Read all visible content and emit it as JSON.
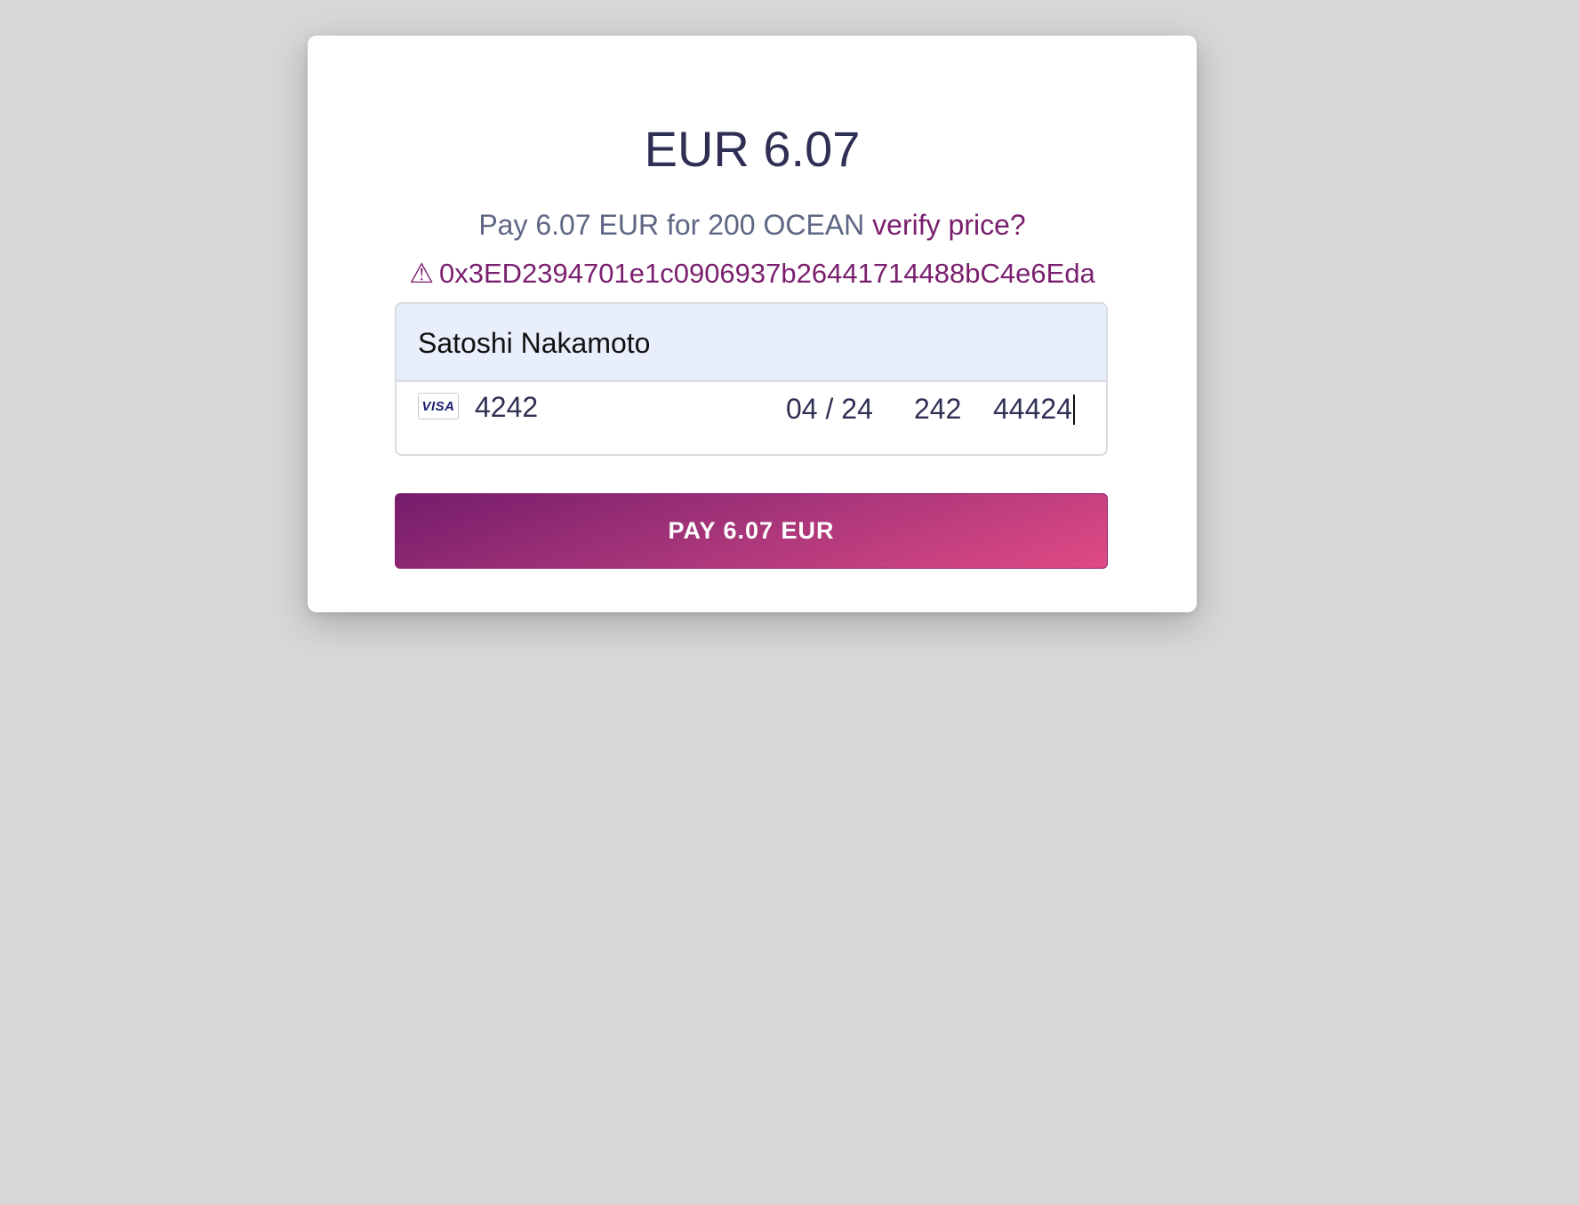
{
  "checkout": {
    "amount_title": "EUR 6.07",
    "description": "Pay 6.07 EUR for 200 OCEAN",
    "verify_link": "verify price?",
    "warning_icon": "⚠",
    "address": "0x3ED2394701e1c0906937b26441714488bC4e6Eda"
  },
  "form": {
    "name_value": "Satoshi Nakamoto",
    "card_brand": "VISA",
    "card_number": "4242",
    "expiry": "04 / 24",
    "cvc": "242",
    "zip": "44424"
  },
  "button": {
    "pay_label": "PAY 6.07 EUR"
  },
  "colors": {
    "background": "#d7d7d7",
    "title": "#2f2f55",
    "accent": "#7a1f6e",
    "button_gradient_start": "#741c6b",
    "button_gradient_end": "#e04a84",
    "name_field_bg": "#e8effb"
  }
}
